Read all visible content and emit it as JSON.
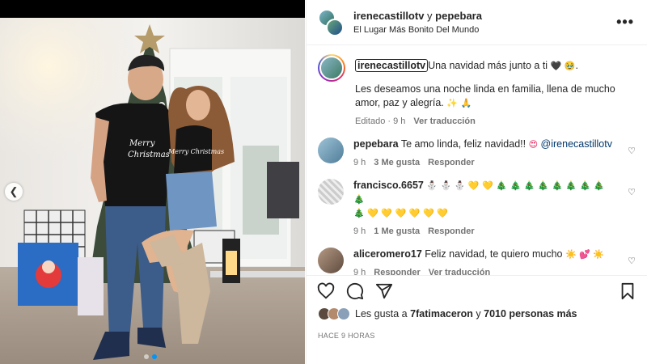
{
  "header": {
    "user1": "irenecastillotv",
    "joiner": " y ",
    "user2": "pepebara",
    "location": "El Lugar Más Bonito Del Mundo",
    "more_icon": "more-horizontal-icon"
  },
  "caption": {
    "username": "irenecastillotv",
    "text": "Una navidad más junto a ti",
    "emoji_1": "🖤",
    "emoji_2": "🥹",
    "line2": "Les deseamos una noche linda en familia, llena de mucho amor, paz y alegría.",
    "emoji_3": "✨",
    "emoji_4": "🙏",
    "edited": "Editado",
    "time": "9 h",
    "translate": "Ver traducción"
  },
  "comments": [
    {
      "username": "pepebara",
      "text": "Te amo linda, feliz navidad!!",
      "emoji": "😍",
      "mention": "@irenecastillotv",
      "time": "9 h",
      "likes": "3 Me gusta",
      "reply": "Responder"
    },
    {
      "username": "francisco.6657",
      "emojis_line1": "⛄ ⛄ ⛄ 💛 💛 🎄 🎄 🎄 🎄 🎄 🎄 🎄 🎄 🎄",
      "emojis_line2": "🎄 💛 💛 💛 💛 💛 💛",
      "time": "9 h",
      "likes": "1 Me gusta",
      "reply": "Responder"
    },
    {
      "username": "aliceromero17",
      "text": "Feliz navidad, te quiero mucho",
      "emojis": "☀️ 💕 ☀️",
      "time": "9 h",
      "reply": "Responder",
      "translate": "Ver traducción"
    }
  ],
  "actions": {
    "like_icon": "heart-icon",
    "comment_icon": "comment-icon",
    "share_icon": "share-icon",
    "save_icon": "bookmark-icon"
  },
  "likes": {
    "prefix": "Les gusta a ",
    "user": "7fatimaceron",
    "middle": " y ",
    "others": "7010 personas más"
  },
  "timestamp": "HACE 9 HORAS",
  "carousel": {
    "prev_icon": "chevron-left-icon",
    "slide_count": 2,
    "active_slide": 2
  }
}
